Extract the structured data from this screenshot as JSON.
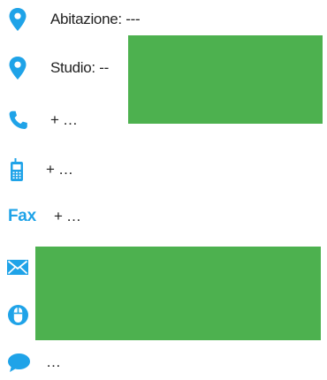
{
  "colors": {
    "icon": "#1fa3e8",
    "redaction": "#4db14f",
    "text": "#222222"
  },
  "contacts": [
    {
      "type": "home-address",
      "icon": "map-pin-icon",
      "text": "Abitazione: ---"
    },
    {
      "type": "office-address",
      "icon": "map-pin-icon",
      "text": "Studio: --"
    },
    {
      "type": "phone",
      "icon": "phone-icon",
      "text": "+ …"
    },
    {
      "type": "mobile",
      "icon": "mobile-phone-icon",
      "text": "+ …"
    },
    {
      "type": "fax",
      "icon_label": "Fax",
      "text": "+ …"
    },
    {
      "type": "email",
      "icon": "envelope-icon",
      "text": ""
    },
    {
      "type": "website",
      "icon": "globe-icon",
      "text": ""
    },
    {
      "type": "chat",
      "icon": "speech-bubble-icon",
      "text": "…"
    }
  ]
}
